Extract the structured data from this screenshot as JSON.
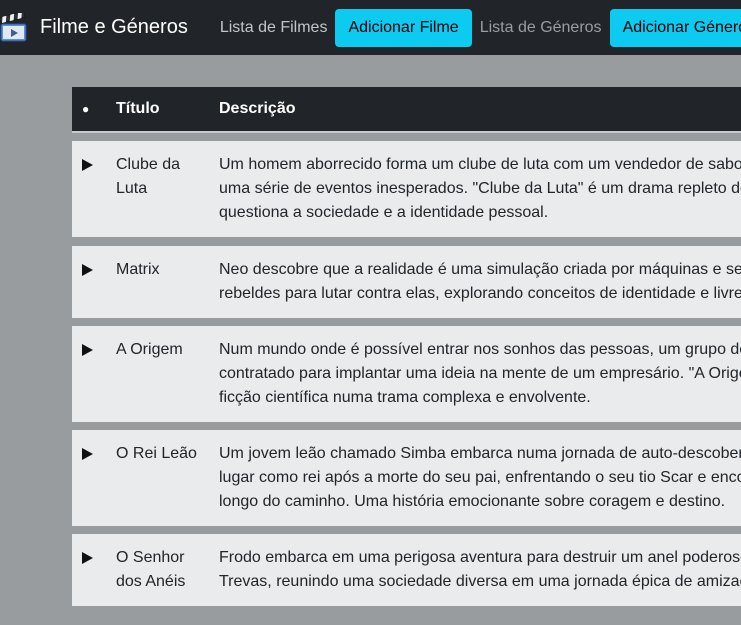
{
  "navbar": {
    "brand": "Filme e Géneros",
    "links": [
      {
        "label": "Lista de Filmes"
      },
      {
        "label": "Adicionar Filme"
      },
      {
        "label": "Lista de Géneros"
      },
      {
        "label": "Adicionar Género"
      }
    ]
  },
  "table": {
    "headers": {
      "bullet": "●",
      "title": "Título",
      "description": "Descrição"
    },
    "rows": [
      {
        "title": "Clube da Luta",
        "desc": [
          "Um homem aborrecido forma um clube de luta com um vendedor de sabo",
          "uma série de eventos inesperados. \"Clube da Luta\" é um drama repleto de",
          "questiona a sociedade e a identidade pessoal."
        ]
      },
      {
        "title": "Matrix",
        "desc": [
          "Neo descobre que a realidade é uma simulação criada por máquinas e se",
          "rebeldes para lutar contra elas, explorando conceitos de identidade e livre"
        ]
      },
      {
        "title": "A Origem",
        "desc": [
          "Num mundo onde é possível entrar nos sonhos das pessoas, um grupo de",
          "contratado para implantar uma ideia na mente de um empresário. \"A Orige",
          "ficção científica numa trama complexa e envolvente."
        ]
      },
      {
        "title": "O Rei Leão",
        "desc": [
          "Um jovem leão chamado Simba embarca numa jornada de auto-descober",
          "lugar como rei após a morte do seu pai, enfrentando o seu tio Scar e enco",
          "longo do caminho. Uma história emocionante sobre coragem e destino."
        ]
      },
      {
        "title": "O Senhor dos Anéis",
        "desc": [
          "Frodo embarca em uma perigosa aventura para destruir um anel poderoso",
          "Trevas, reunindo uma sociedade diversa em uma jornada épica de amizad"
        ]
      }
    ]
  }
}
